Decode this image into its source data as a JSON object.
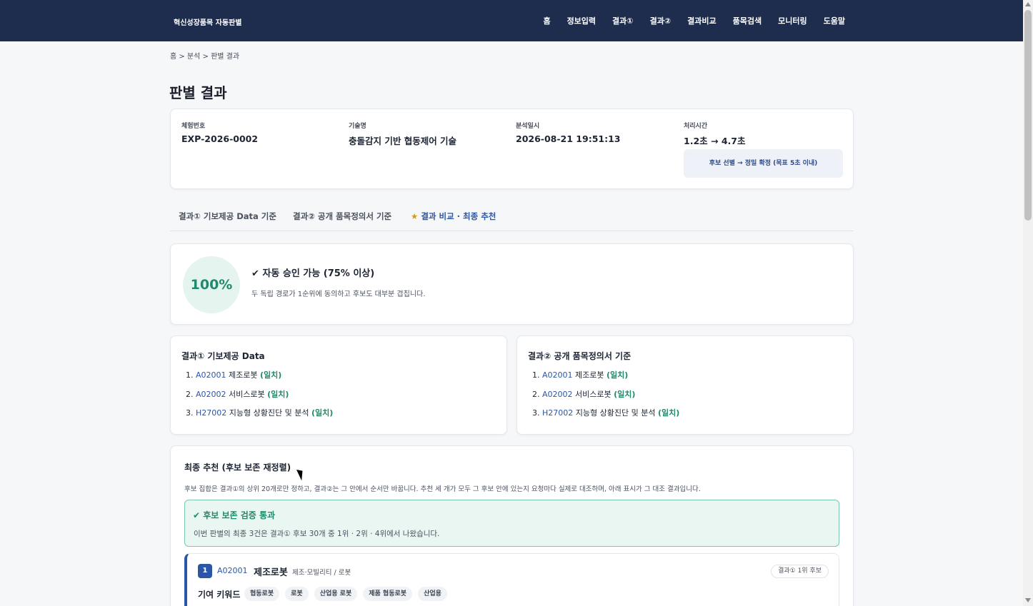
{
  "nav": {
    "brand": "혁신성장품목 자동판별",
    "links": [
      "홈",
      "정보입력",
      "결과①",
      "결과②",
      "결과비교",
      "품목검색",
      "모니터링",
      "도움말"
    ]
  },
  "breadcrumb": "홈 > 분석 > 판별 결과",
  "page_title": "판별 결과",
  "info": {
    "experiment_label": "체험번호",
    "experiment_value": "EXP-2026-0002",
    "tech_label": "기술명",
    "tech_value": "충돌감지 기반 협동제어 기술",
    "date_label": "분석일시",
    "date_value": "2026-08-21 19:51:13",
    "time_label": "처리시간",
    "time_value": "1.2초 → 4.7초",
    "note": "후보 선별 → 정밀 확정 (목표 5초 이내)"
  },
  "tabs": {
    "tab1": "결과① 기보제공 Data 기준",
    "tab2": "결과② 공개 품목정의서 기준",
    "tab3_star": "★",
    "tab3": "결과 비교 · 최종 추천"
  },
  "score": {
    "value": "100%",
    "title": "✔ 자동 승인 가능 (75% 이상)",
    "desc": "두 독립 경로가 1순위에 동의하고 후보도 대부분 겹칩니다."
  },
  "result1": {
    "title": "결과① 기보제공 Data",
    "items": [
      {
        "num": "1.",
        "code": "A02001",
        "name": "제조로봇",
        "status": "(일치)"
      },
      {
        "num": "2.",
        "code": "A02002",
        "name": "서비스로봇",
        "status": "(일치)"
      },
      {
        "num": "3.",
        "code": "H27002",
        "name": "지능형 상황진단 및 분석",
        "status": "(일치)"
      }
    ]
  },
  "result2": {
    "title": "결과② 공개 품목정의서 기준",
    "items": [
      {
        "num": "1.",
        "code": "A02001",
        "name": "제조로봇",
        "status": "(일치)"
      },
      {
        "num": "2.",
        "code": "A02002",
        "name": "서비스로봇",
        "status": "(일치)"
      },
      {
        "num": "3.",
        "code": "H27002",
        "name": "지능형 상황진단 및 분석",
        "status": "(일치)"
      }
    ]
  },
  "final": {
    "title": "최종 추천 (후보 보존 재정렬)",
    "desc": "후보 집합은 결과①의 상위 20개로만 정하고, 결과②는 그 안에서 순서만 바꿉니다. 추천 세 개가 모두 그 후보 안에 있는지 요청마다 실제로 대조하며, 아래 표시가 그 대조 결과입니다.",
    "pass_title": "✔ 후보 보존 검증 통과",
    "pass_desc": "이번 판별의 최종 3건은 결과① 후보 30개 중 1위 · 2위 · 4위에서 나왔습니다."
  },
  "recommendation": {
    "rank": "1",
    "code": "A02001",
    "name": "제조로봇",
    "category": "제조·모빌리티 / 로봇",
    "tag": "결과① 1위 후보",
    "keyword_label": "기여 키워드",
    "keywords": [
      "협동로봇",
      "로봇",
      "산업용 로봇",
      "제품 협동로봇",
      "산업용"
    ]
  }
}
